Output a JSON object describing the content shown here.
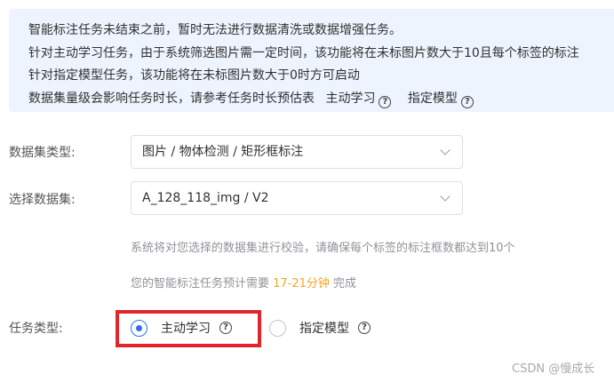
{
  "notice": {
    "lines": [
      "智能标注任务未结束之前，暂时无法进行数据清洗或数据增强任务。",
      "针对主动学习任务，由于系统筛选图片需一定时间，该功能将在未标图片数大于10且每个标签的标注",
      "针对指定模型任务，该功能将在未标图片数大于0时方可启动"
    ],
    "last_line_text": "数据集量级会影响任务时长，请参考任务时长预估表",
    "link_active_learning": "主动学习",
    "link_specified_model": "指定模型",
    "help_glyph": "?"
  },
  "form": {
    "dataset_type": {
      "label": "数据集类型:",
      "value": "图片 / 物体检测 / 矩形框标注"
    },
    "dataset": {
      "label": "选择数据集:",
      "value": "A_128_118_img / V2"
    },
    "check_hint": "系统将对您选择的数据集进行校验，请确保每个标签的标注框数都达到10个",
    "estimate": {
      "prefix": "您的智能标注任务预计需要 ",
      "time": "17-21分钟",
      "suffix": " 完成",
      "highlight_color": "#f5a623"
    },
    "task_type": {
      "label": "任务类型:",
      "options": [
        {
          "label": "主动学习",
          "selected": true
        },
        {
          "label": "指定模型",
          "selected": false
        }
      ]
    }
  },
  "watermark": "CSDN @慢成长",
  "colors": {
    "accent": "#2f6fea",
    "notice_bg": "#eef4fd",
    "highlight_border": "#e0262b"
  }
}
